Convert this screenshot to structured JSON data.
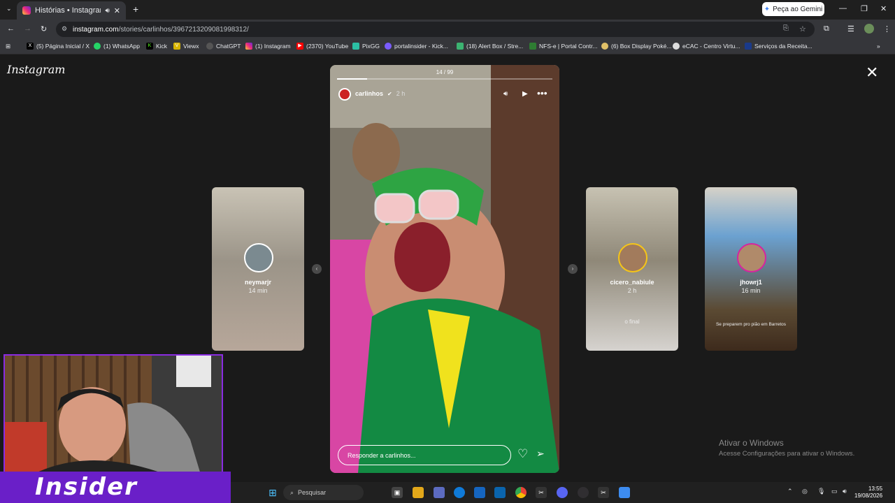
{
  "browser": {
    "tab_title": "Histórias • Instagram",
    "url_host": "instagram.com",
    "url_path": "/stories/carlinhos/3967213209081998312/",
    "gemini_label": "Peça ao Gemini",
    "new_tab": "+",
    "bookmarks": [
      "(5) Página Inicial / X",
      "(1) WhatsApp",
      "Kick",
      "Viewx",
      "ChatGPT",
      "(1) Instagram",
      "(2370) YouTube",
      "PixGG",
      "portalinsider - Kick...",
      "(18) Alert Box / Stre...",
      "NFS-e | Portal Contr...",
      "(6) Box Display Poké...",
      "eCAC - Centro Virtu...",
      "Serviços da Receita..."
    ]
  },
  "instagram": {
    "logo": "Instagram",
    "story_counter": "14 / 99",
    "progress": 0.14,
    "current_user": "carlinhos",
    "current_time": "2 h",
    "reply_placeholder": "Responder a carlinhos...",
    "side_stories": [
      {
        "name": "neymarjr",
        "time": "14 min"
      },
      {
        "name": "cicero_nabiule",
        "time": "2 h",
        "caption": "o final"
      },
      {
        "name": "jhowrj1",
        "time": "16 min",
        "caption": "Se preparem pro pião em Barretos"
      }
    ]
  },
  "windows": {
    "activate_title": "Ativar o Windows",
    "activate_sub": "Acesse Configurações para ativar o Windows.",
    "search_placeholder": "Pesquisar",
    "time": "13:55",
    "date": "19/08/2026"
  },
  "overlay": {
    "banner_text": "Insider"
  },
  "colors": {
    "chrome_bg": "#35363a",
    "ig_bg": "#1a1a1a",
    "banner": "#6a1fc8"
  }
}
